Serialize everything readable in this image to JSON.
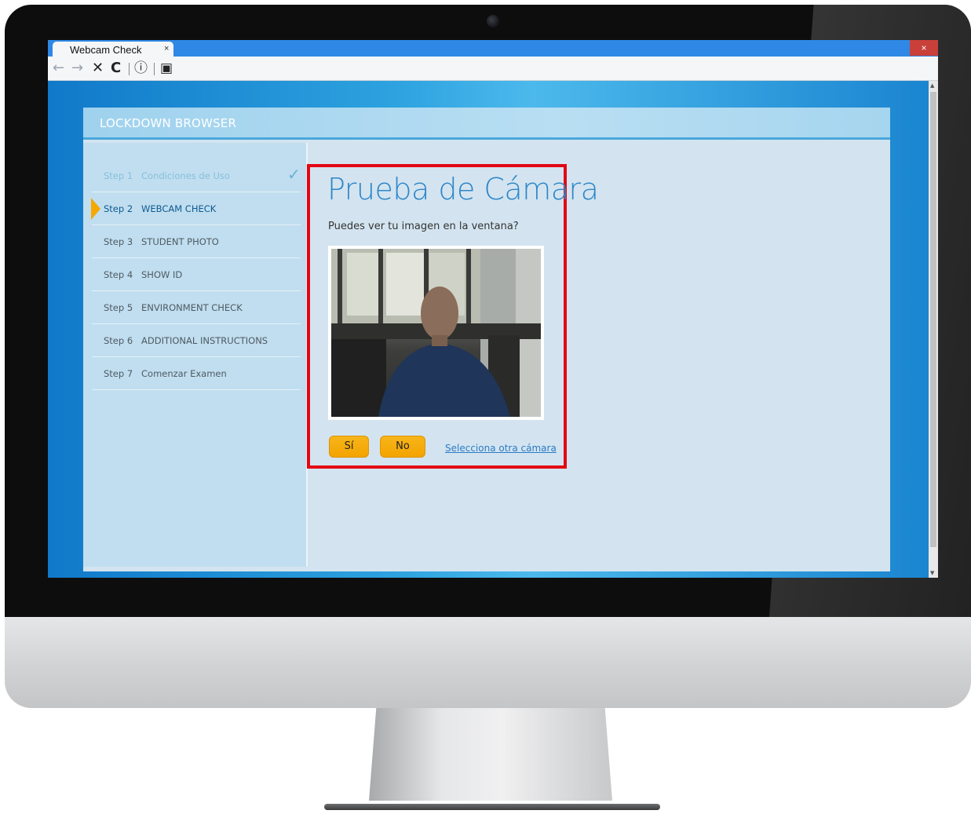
{
  "browser": {
    "tab_title": "Webcam Check",
    "tab_close": "×",
    "window_close": "×",
    "toolbar": {
      "back": "←",
      "forward": "→",
      "stop": "✕",
      "reload": "C",
      "info": "ⓘ",
      "reader": "▣"
    }
  },
  "app": {
    "title": "LOCKDOWN BROWSER"
  },
  "steps": [
    {
      "num": "Step 1",
      "label": "Condiciones de Uso",
      "state": "done"
    },
    {
      "num": "Step 2",
      "label": "WEBCAM CHECK",
      "state": "active"
    },
    {
      "num": "Step 3",
      "label": "STUDENT PHOTO",
      "state": "pending"
    },
    {
      "num": "Step 4",
      "label": "SHOW ID",
      "state": "pending"
    },
    {
      "num": "Step 5",
      "label": "ENVIRONMENT CHECK",
      "state": "pending"
    },
    {
      "num": "Step 6",
      "label": "ADDITIONAL INSTRUCTIONS",
      "state": "pending"
    },
    {
      "num": "Step 7",
      "label": "Comenzar Examen",
      "state": "pending"
    }
  ],
  "webcam": {
    "title": "Prueba de Cámara",
    "question": "Puedes ver tu imagen en la ventana?",
    "yes_label": "Sí",
    "no_label": "No",
    "other_camera_link": "Selecciona otra cámara"
  },
  "colors": {
    "accent": "#f3a300",
    "highlight_border": "#e30613",
    "title_blue": "#2f86c8"
  }
}
